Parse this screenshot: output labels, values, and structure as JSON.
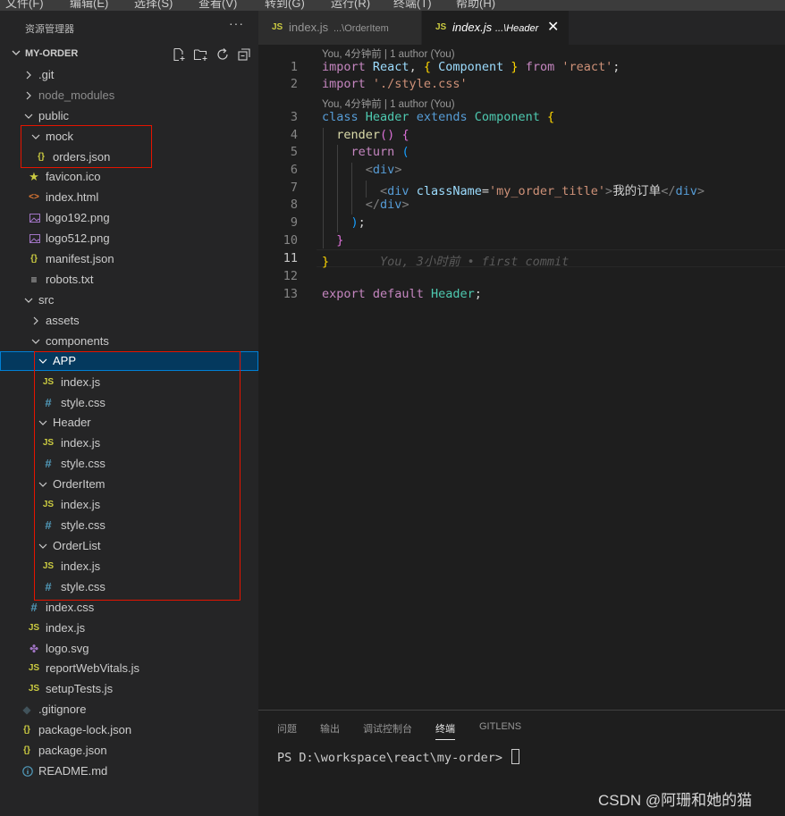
{
  "menubar": {
    "items": [
      "文件(F)",
      "编辑(E)",
      "选择(S)",
      "查看(V)",
      "转到(G)",
      "运行(R)",
      "终端(T)",
      "帮助(H)"
    ]
  },
  "explorer": {
    "title": "资源管理器",
    "more": "···",
    "project": "MY-ORDER",
    "actions": [
      "new-file-icon",
      "new-folder-icon",
      "refresh-icon",
      "collapse-all-icon"
    ],
    "tree": [
      {
        "label": ".git",
        "type": "folder",
        "expanded": false
      },
      {
        "label": "node_modules",
        "type": "folder",
        "expanded": false,
        "dim": true
      },
      {
        "label": "public",
        "type": "folder",
        "expanded": true
      },
      {
        "label": "mock",
        "type": "folder",
        "expanded": true
      },
      {
        "label": "orders.json",
        "type": "json"
      },
      {
        "label": "favicon.ico",
        "type": "ico"
      },
      {
        "label": "index.html",
        "type": "html"
      },
      {
        "label": "logo192.png",
        "type": "png"
      },
      {
        "label": "logo512.png",
        "type": "png"
      },
      {
        "label": "manifest.json",
        "type": "json"
      },
      {
        "label": "robots.txt",
        "type": "txt"
      },
      {
        "label": "src",
        "type": "folder",
        "expanded": true
      },
      {
        "label": "assets",
        "type": "folder",
        "expanded": false
      },
      {
        "label": "components",
        "type": "folder",
        "expanded": true
      },
      {
        "label": "APP",
        "type": "folder",
        "expanded": true,
        "selected": true
      },
      {
        "label": "index.js",
        "type": "js"
      },
      {
        "label": "style.css",
        "type": "css"
      },
      {
        "label": "Header",
        "type": "folder",
        "expanded": true
      },
      {
        "label": "index.js",
        "type": "js"
      },
      {
        "label": "style.css",
        "type": "css"
      },
      {
        "label": "OrderItem",
        "type": "folder",
        "expanded": true
      },
      {
        "label": "index.js",
        "type": "js"
      },
      {
        "label": "style.css",
        "type": "css"
      },
      {
        "label": "OrderList",
        "type": "folder",
        "expanded": true
      },
      {
        "label": "index.js",
        "type": "js"
      },
      {
        "label": "style.css",
        "type": "css"
      },
      {
        "label": "index.css",
        "type": "css"
      },
      {
        "label": "index.js",
        "type": "js"
      },
      {
        "label": "logo.svg",
        "type": "svg"
      },
      {
        "label": "reportWebVitals.js",
        "type": "js"
      },
      {
        "label": "setupTests.js",
        "type": "js"
      },
      {
        "label": ".gitignore",
        "type": "git"
      },
      {
        "label": "package-lock.json",
        "type": "json"
      },
      {
        "label": "package.json",
        "type": "json"
      },
      {
        "label": "README.md",
        "type": "info"
      }
    ]
  },
  "tabs": [
    {
      "icon": "JS",
      "name": "index.js",
      "path": "...\\OrderItem",
      "active": false
    },
    {
      "icon": "JS",
      "name": "index.js",
      "path": "...\\Header",
      "active": true,
      "close": "✕"
    }
  ],
  "editor": {
    "codelens": [
      "You, 4分钟前 | 1 author (You)",
      "You, 4分钟前 | 1 author (You)"
    ],
    "line_numbers": [
      "1",
      "2",
      "3",
      "4",
      "5",
      "6",
      "7",
      "8",
      "9",
      "10",
      "11",
      "12",
      "13"
    ],
    "active_line": "11",
    "blame": "You, 3小时前 • first commit",
    "lines": [
      "import React, { Component } from 'react';",
      "import './style.css'",
      "class Header extends Component {",
      "  render() {",
      "    return (",
      "      <div>",
      "        <div className='my_order_title'>我的订单</div>",
      "      </div>",
      "    );",
      "  }",
      "}",
      "",
      "export default Header;"
    ]
  },
  "panel": {
    "tabs": [
      "问题",
      "输出",
      "调试控制台",
      "终端",
      "GITLENS"
    ],
    "active_tab": "终端",
    "prompt": "PS D:\\workspace\\react\\my-order> "
  },
  "watermark": "CSDN @阿珊和她的猫",
  "colors": {
    "highlight_box": "#e51400",
    "selection": "#04395e",
    "js_icon": "#cbcb41",
    "css_icon": "#519aba",
    "json_icon": "#cbcb41"
  }
}
